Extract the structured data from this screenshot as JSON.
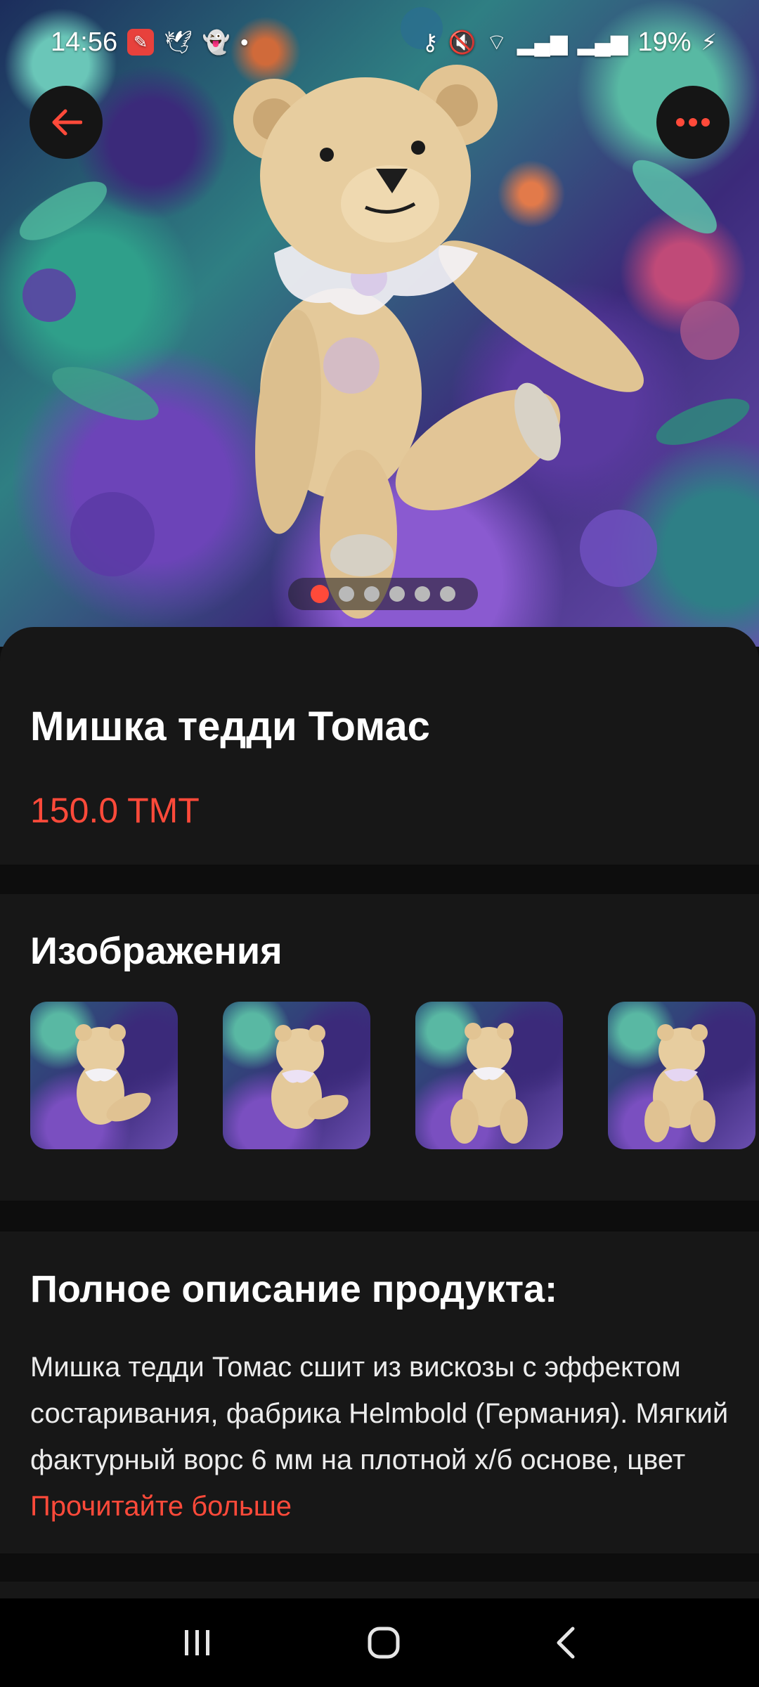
{
  "status_bar": {
    "time": "14:56",
    "battery": "19%",
    "icons_left": [
      "app-badge-icon",
      "twitter-icon",
      "snapchat-icon",
      "dot-icon"
    ],
    "icons_right": [
      "vpn-key-icon",
      "mute-icon",
      "wifi-icon",
      "signal-icon",
      "signal-icon",
      "battery-charging-icon"
    ]
  },
  "gallery": {
    "image_count": 6,
    "active_index": 0
  },
  "product": {
    "title": "Мишка тедди Томас",
    "price": "150.0 TMT"
  },
  "images_section": {
    "title": "Изображения",
    "thumbnail_count": 4
  },
  "description_section": {
    "title": "Полное описание продукта:",
    "text": "Мишка тедди Томас сшит из вискозы с эффектом состаривания, фабрика Helmbold (Германия). Мягкий фактурный ворс 6 мм на плотной х/б основе, цвет ",
    "read_more": "Прочитайте больше"
  },
  "colors": {
    "accent": "#ff4a3a",
    "background": "#0d0d0d",
    "card": "#171717"
  }
}
